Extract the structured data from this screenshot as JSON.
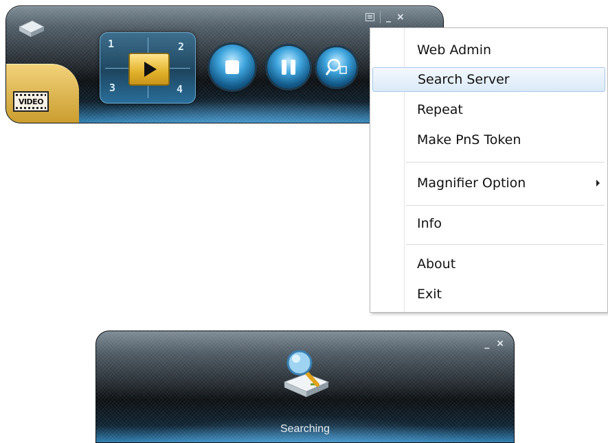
{
  "player": {
    "video_tab_label": "VIDEO",
    "split_numbers": [
      "1",
      "2",
      "3",
      "4"
    ],
    "title_controls": {
      "minimize": "_",
      "close": "×"
    }
  },
  "context_menu": {
    "items": [
      {
        "label": "Web Admin"
      },
      {
        "label": "Search Server",
        "highlighted": true
      },
      {
        "label": "Repeat"
      },
      {
        "label": "Make PnS Token"
      },
      {
        "label": "Magnifier Option",
        "has_submenu": true
      },
      {
        "label": "Info"
      },
      {
        "label": "About"
      },
      {
        "label": "Exit"
      }
    ]
  },
  "search_window": {
    "status": "Searching",
    "title_controls": {
      "minimize": "_",
      "close": "×"
    }
  },
  "colors": {
    "accent_blue": "#3fa5dd",
    "play_gold": "#e1b12a",
    "menu_highlight": "#dbeaf8"
  }
}
